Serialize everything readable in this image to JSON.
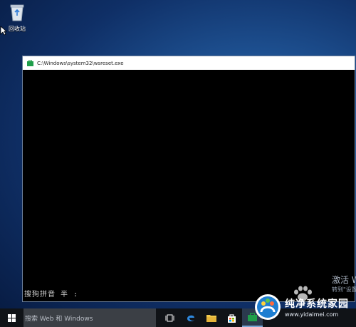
{
  "desktop": {
    "recycle_bin_label": "回收站"
  },
  "console_window": {
    "title": "C:\\Windows\\system32\\wsreset.exe",
    "ime_status": "搜狗拼音 半 :"
  },
  "activation_watermark": {
    "line1": "激活 W",
    "line2": "转到\"设置"
  },
  "taskbar": {
    "search_placeholder": "搜索 Web 和 Windows",
    "accent": "#2b3a4e"
  },
  "brand_watermark": {
    "name": "纯净系统家园",
    "url": "www.yidaimei.com"
  }
}
